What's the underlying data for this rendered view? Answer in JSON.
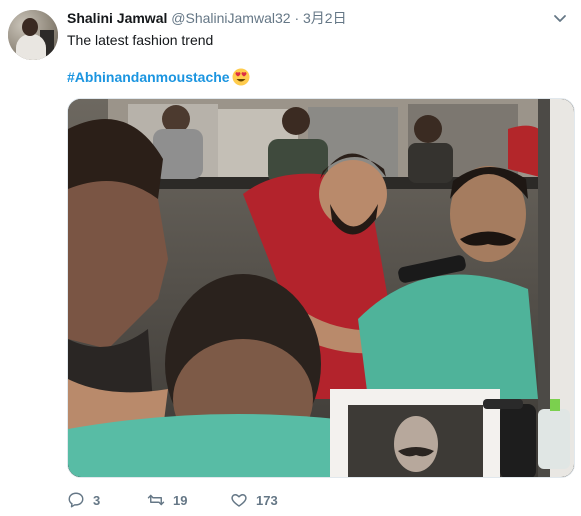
{
  "tweet": {
    "author": {
      "name": "Shalini Jamwal",
      "handle": "@ShaliniJamwal32",
      "separator": "·",
      "date": "3月2日"
    },
    "text": "The latest fashion trend",
    "hashtag": "#Abhinandanmoustache",
    "emoji_icon": "heart-eyes-emoji",
    "media": {
      "kind": "photo",
      "icon": "photo-barber-shop"
    },
    "actions": {
      "replies": "3",
      "retweets": "19",
      "likes": "173"
    },
    "colors": {
      "link": "#1b95e0",
      "secondary_text": "#657786",
      "primary_text": "#14171a"
    }
  }
}
